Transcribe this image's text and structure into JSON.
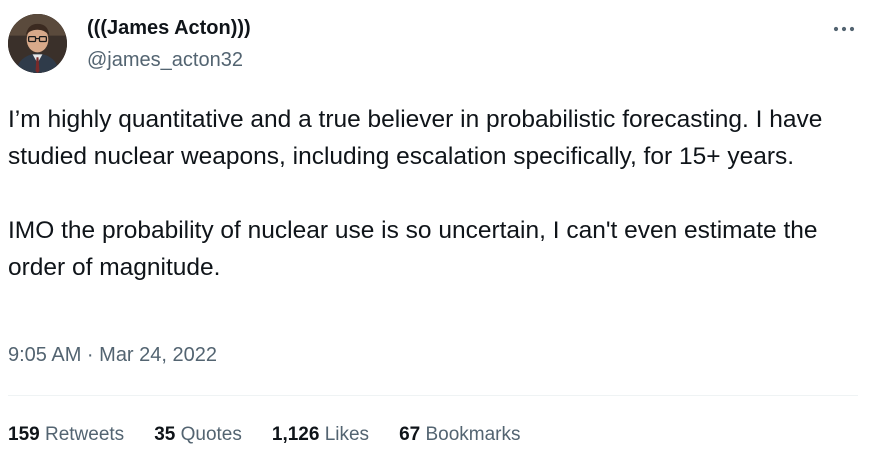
{
  "author": {
    "display_name": "(((James Acton)))",
    "handle": "@james_acton32"
  },
  "tweet": {
    "paragraphs": [
      "I’m highly quantitative and a true believer in probabilistic forecasting. I have studied nuclear weapons, including escalation specifically, for 15+ years.",
      "IMO the probability of nuclear use is so uncertain, I can't even estimate the order of magnitude."
    ],
    "timestamp": "9:05 AM · Mar 24, 2022"
  },
  "stats": {
    "retweets": {
      "count": "159",
      "label": "Retweets"
    },
    "quotes": {
      "count": "35",
      "label": "Quotes"
    },
    "likes": {
      "count": "1,126",
      "label": "Likes"
    },
    "bookmarks": {
      "count": "67",
      "label": "Bookmarks"
    }
  },
  "icons": {
    "more": "more-horizontal-icon"
  },
  "colors": {
    "text_primary": "#0f1419",
    "text_secondary": "#536471",
    "divider": "#eff3f4"
  }
}
